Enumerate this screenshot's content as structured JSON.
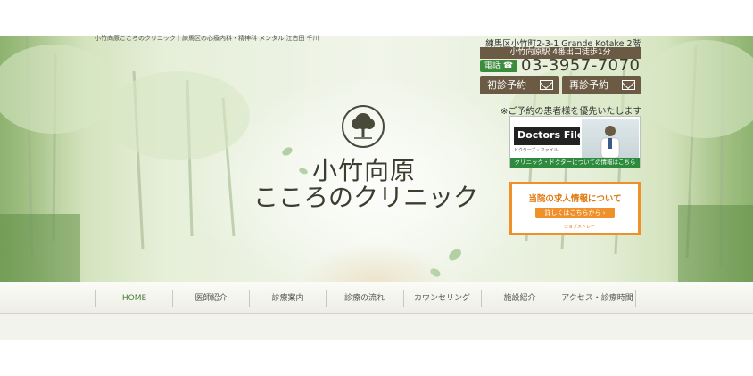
{
  "header": {
    "tagline": "小竹向原こころのクリニック｜練馬区の心療内科・精神科 メンタル 江古田 千川"
  },
  "clinic": {
    "name_line1": "小竹向原",
    "name_line2": "こころのクリニック"
  },
  "contact": {
    "address": "練馬区小竹町2-3-1 Grande Kotake 2階",
    "station": "小竹向原駅 4番出口徒歩1分",
    "phone_label": "電話",
    "phone_number": "03-3957-7070",
    "first_visit_label": "初診予約",
    "revisit_label": "再診予約",
    "note": "※ご予約の患者様を優先いたします"
  },
  "banners": {
    "doctors_file_title": "Doctors File",
    "doctors_file_sub": "ドクターズ・ファイル",
    "doctors_file_footer": "クリニック・ドクターについての情報はこちら",
    "recruit_title": "当院の求人情報について",
    "recruit_button": "詳しくはこちらから",
    "recruit_logo": "ジョブメドレー"
  },
  "nav": {
    "items": [
      "HOME",
      "医師紹介",
      "診療案内",
      "診療の流れ",
      "カウンセリング",
      "施設紹介",
      "アクセス・診療時間"
    ]
  },
  "colors": {
    "brown": "#6b5a44",
    "green": "#3d8b3d",
    "orange": "#f0902a"
  }
}
